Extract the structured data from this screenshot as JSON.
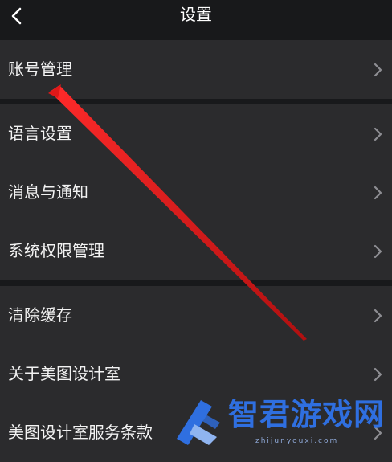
{
  "header": {
    "title": "设置"
  },
  "groups": [
    {
      "items": [
        {
          "label": "账号管理"
        }
      ]
    },
    {
      "items": [
        {
          "label": "语言设置"
        },
        {
          "label": "消息与通知"
        },
        {
          "label": "系统权限管理"
        }
      ]
    },
    {
      "items": [
        {
          "label": "清除缓存"
        },
        {
          "label": "关于美图设计室"
        },
        {
          "label": "美图设计室服务条款"
        }
      ]
    }
  ],
  "watermark": {
    "text": "智君游戏网",
    "url": "zhijunyouxi.com"
  },
  "colors": {
    "background": "#18191b",
    "row": "#2b2b2d",
    "text": "#f2f2f2",
    "chevron": "#8e8e93",
    "annotation": "#e01818",
    "watermark": "#2f6fe0"
  },
  "icons": {
    "back": "chevron-left-icon",
    "row": "chevron-right-icon"
  }
}
